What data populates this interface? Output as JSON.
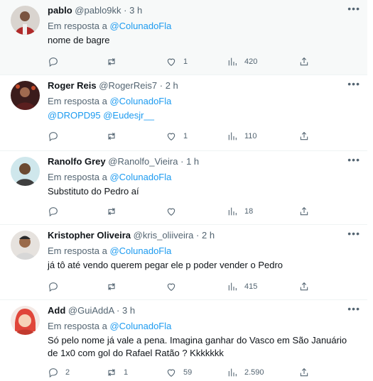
{
  "tweets": [
    {
      "name": "pablo",
      "handle": "@pablo9kk",
      "sep": "·",
      "time": "3 h",
      "reply_prefix": "Em resposta a",
      "reply_to": "@ColunadoFla",
      "text_lines": [
        "nome de bagre"
      ],
      "mentions_line": "",
      "replies": "",
      "retweets": "",
      "likes": "1",
      "views": "420",
      "avatar_color": "#b02a2a"
    },
    {
      "name": "Roger Reis",
      "handle": "@RogerReis7",
      "sep": "·",
      "time": "2 h",
      "reply_prefix": "Em resposta a",
      "reply_to": "@ColunadoFla",
      "text_lines": [],
      "mentions_line": "@DROPD95 @Eudesjr__",
      "replies": "",
      "retweets": "",
      "likes": "1",
      "views": "110",
      "avatar_color": "#5a1f1f"
    },
    {
      "name": "Ranolfo Grey",
      "handle": "@Ranolfo_Vieira",
      "sep": "·",
      "time": "1 h",
      "reply_prefix": "Em resposta a",
      "reply_to": "@ColunadoFla",
      "text_lines": [
        "Substituto do Pedro aí"
      ],
      "mentions_line": "",
      "replies": "",
      "retweets": "",
      "likes": "",
      "views": "18",
      "avatar_color": "#7a5a3c"
    },
    {
      "name": "Kristopher Oliveira",
      "handle": "@kris_oliiveira",
      "sep": "·",
      "time": "2 h",
      "reply_prefix": "Em resposta a",
      "reply_to": "@ColunadoFla",
      "text_lines": [
        "já tô até vendo querem pegar ele p poder vender o Pedro"
      ],
      "mentions_line": "",
      "replies": "",
      "retweets": "",
      "likes": "",
      "views": "415",
      "avatar_color": "#8a6a4f"
    },
    {
      "name": "Add",
      "handle": "@GuiAddA",
      "sep": "·",
      "time": "3 h",
      "reply_prefix": "Em resposta a",
      "reply_to": "@ColunadoFla",
      "text_lines": [
        "Só pelo nome já vale a pena. Imagina ganhar do Vasco em São Januário",
        "de 1x0 com gol do Rafael Ratão ? Kkkkkkk"
      ],
      "mentions_line": "",
      "replies": "2",
      "retweets": "1",
      "likes": "59",
      "views": "2.590",
      "avatar_color": "#e0463a"
    }
  ],
  "more_icon": "more-horizontal-icon",
  "colors": {
    "link": "#1d9bf0",
    "muted": "#536471",
    "text": "#0f1419"
  }
}
